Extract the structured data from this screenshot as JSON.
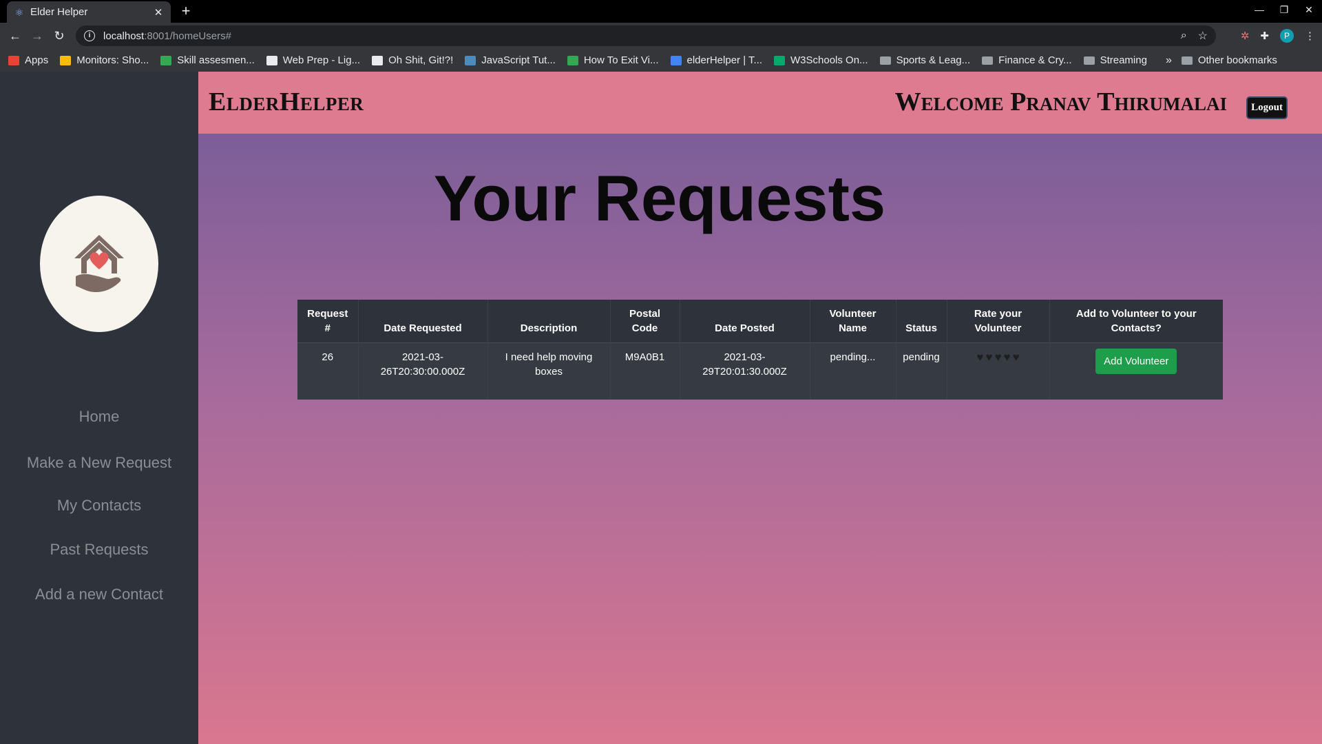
{
  "browser": {
    "tab_title": "Elder Helper",
    "new_tab": "+",
    "url_host": "localhost",
    "url_rest": ":8001/homeUsers#",
    "bookmarks": [
      {
        "label": "Apps",
        "color": "#ea4335"
      },
      {
        "label": "Monitors: Sho...",
        "color": "#fbbc04"
      },
      {
        "label": "Skill assesmen...",
        "color": "#34a853"
      },
      {
        "label": "Web Prep - Lig...",
        "color": "#e8eaed"
      },
      {
        "label": "Oh Shit, Git!?!",
        "color": "#e8eaed"
      },
      {
        "label": "JavaScript Tut...",
        "color": "#4b8bbe"
      },
      {
        "label": "How To Exit Vi...",
        "color": "#34a853"
      },
      {
        "label": "elderHelper | T...",
        "color": "#4285f4"
      },
      {
        "label": "W3Schools On...",
        "color": "#04aa6d"
      },
      {
        "label": "Sports & Leag...",
        "folder": true
      },
      {
        "label": "Finance & Cry...",
        "folder": true
      },
      {
        "label": "Streaming",
        "folder": true
      }
    ],
    "bookmarks_more": "»",
    "other_bookmarks": "Other bookmarks",
    "profile_initial": "P"
  },
  "sidebar": {
    "items": [
      {
        "label": "Home"
      },
      {
        "label": "Make a New Request"
      },
      {
        "label": "My Contacts"
      },
      {
        "label": "Past Requests"
      },
      {
        "label": "Add a new Contact"
      }
    ]
  },
  "header": {
    "brand": "ElderHelper",
    "welcome": "Welcome Pranav Thirumalai",
    "logout_label": "Logout"
  },
  "main": {
    "title": "Your Requests",
    "columns": [
      "Request #",
      "Date Requested",
      "Description",
      "Postal Code",
      "Date Posted",
      "Volunteer Name",
      "Status",
      "Rate your Volunteer",
      "Add to Volunteer to your Contacts?"
    ],
    "rows": [
      {
        "request_no": "26",
        "date_requested": "2021-03-26T20:30:00.000Z",
        "description": "I need help moving boxes",
        "postal_code": "M9A0B1",
        "date_posted": "2021-03-29T20:01:30.000Z",
        "volunteer_name": "pending...",
        "status": "pending",
        "rating": 0,
        "rating_max": 5,
        "add_button": "Add Volunteer"
      }
    ]
  },
  "colors": {
    "sidebar_bg": "#2e323a",
    "header_bg": "#df7b91",
    "gradient_top": "#7c5e98",
    "gradient_bottom": "#d9778f",
    "add_button": "#1e9e4a"
  }
}
